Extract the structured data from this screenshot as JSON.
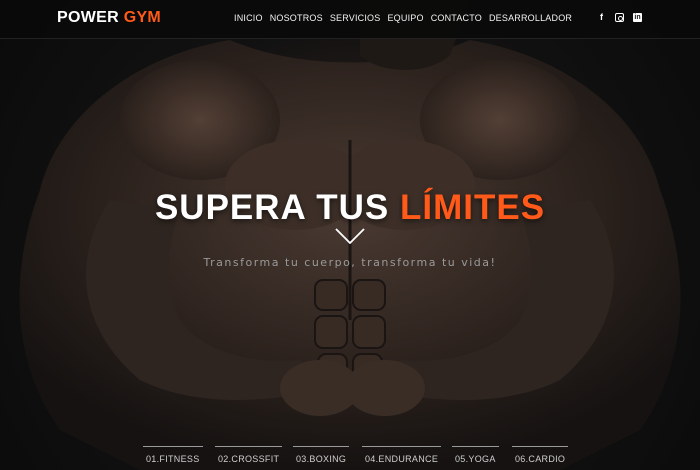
{
  "header": {
    "logo_word1": "POWER",
    "logo_word2": "GYM",
    "nav": [
      "INICIO",
      "NOSOTROS",
      "SERVICIOS",
      "EQUIPO",
      "CONTACTO",
      "DESARROLLADOR"
    ],
    "social_icons": [
      "facebook-icon",
      "instagram-icon",
      "linkedin-icon"
    ]
  },
  "hero": {
    "headline_word1": "SUPERA TUS",
    "headline_word2": "LÍMITES",
    "tagline": "Transforma tu cuerpo, transforma tu vida!",
    "scroll_icon": "chevron-down-icon"
  },
  "categories": [
    "01.FITNESS",
    "02.CROSSFIT",
    "03.BOXING",
    "04.ENDURANCE",
    "05.YOGA",
    "06.CARDIO"
  ],
  "colors": {
    "accent": "#ff5a1a",
    "header_bg": "#0a0a0a",
    "text": "#ffffff"
  }
}
